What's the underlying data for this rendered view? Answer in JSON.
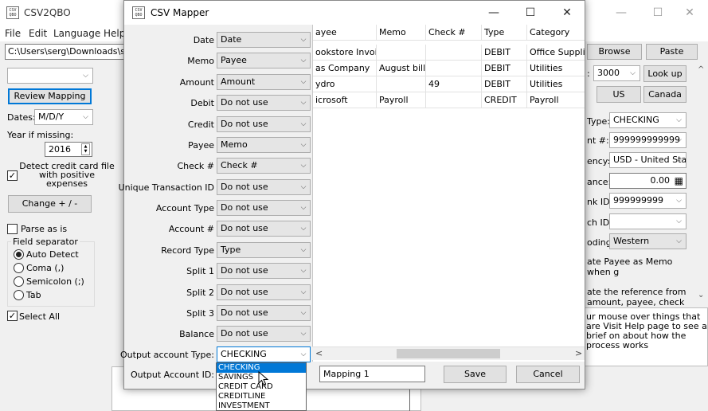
{
  "main": {
    "icon_text": "CSV\nQBO",
    "title": "CSV2QBO",
    "menu": [
      "File",
      "Edit",
      "Language",
      "Help"
    ],
    "path": "C:\\Users\\serg\\Downloads\\sampl",
    "review_mapping": "Review Mapping",
    "dates_label": "Dates:",
    "dates_value": "M/D/Y",
    "year_label": "Year if missing:",
    "year_value": "2016",
    "detect_label": "Detect credit card file with positive expenses",
    "change_label": "Change + / -",
    "parse_label": "Parse as is",
    "separator_title": "Field separator",
    "sep_auto": "Auto Detect",
    "sep_coma": "Coma (,)",
    "sep_semicolon": "Semicolon (;)",
    "sep_tab": "Tab",
    "select_all": "Select All",
    "browse": "Browse",
    "paste": "Paste",
    "colon": ":",
    "lookup_value": "3000",
    "lookup": "Look up",
    "us": "US",
    "canada": "Canada",
    "type_label": "Type:",
    "type_value": "CHECKING",
    "acct_label": "nt #:",
    "acct_value": "999999999999",
    "currency_label": "ency:",
    "currency_value": "USD - United Sta",
    "balance_label": "ance:",
    "balance_value": "0.00",
    "bankid_label": "nk ID:",
    "bankid_value": "999999999",
    "branchid_label": "ch ID:",
    "encoding_label": "oding:",
    "encoding_value": "Western",
    "payee_memo": "ate Payee as Memo when g",
    "reference": "ate the reference from amount, payee, check",
    "hint": "ur mouse over things that are Visit Help page to see a brief on about how the process works"
  },
  "mapper": {
    "title": "CSV Mapper",
    "icon_text": "CSV\nQBO",
    "fields": [
      {
        "label": "Date",
        "value": "Date"
      },
      {
        "label": "Memo",
        "value": "Payee"
      },
      {
        "label": "Amount",
        "value": "Amount"
      },
      {
        "label": "Debit",
        "value": "Do not use"
      },
      {
        "label": "Credit",
        "value": "Do not use"
      },
      {
        "label": "Payee",
        "value": "Memo"
      },
      {
        "label": "Check #",
        "value": "Check #"
      },
      {
        "label": "Unique Transaction ID",
        "value": "Do not use"
      },
      {
        "label": "Account Type",
        "value": "Do not use"
      },
      {
        "label": "Account #",
        "value": "Do not use"
      },
      {
        "label": "Record Type",
        "value": "Type"
      },
      {
        "label": "Split 1",
        "value": "Do not use"
      },
      {
        "label": "Split 2",
        "value": "Do not use"
      },
      {
        "label": "Split 3",
        "value": "Do not use"
      },
      {
        "label": "Balance",
        "value": "Do not use"
      }
    ],
    "output_type_label": "Output account Type:",
    "output_type_value": "CHECKING",
    "output_id_label": "Output Account ID:",
    "dropdown_options": [
      "CHECKING",
      "SAVINGS",
      "CREDIT CARD",
      "CREDITLINE",
      "INVESTMENT"
    ],
    "columns": [
      "ayee",
      "Memo",
      "Check #",
      "Type",
      "Category"
    ],
    "rows": [
      [
        "ookstore Invoice",
        "",
        "",
        "DEBIT",
        "Office Supplies"
      ],
      [
        "as Company",
        "August bill",
        "",
        "DEBIT",
        "Utilities"
      ],
      [
        "ydro",
        "",
        "49",
        "DEBIT",
        "Utilities"
      ],
      [
        "icrosoft",
        "Payroll",
        "",
        "CREDIT",
        "Payroll"
      ]
    ],
    "mapping_name": "Mapping 1",
    "save": "Save",
    "cancel": "Cancel"
  },
  "glyphs": {
    "minimize": "—",
    "maximize": "☐",
    "close": "✕",
    "combo_arrow": "⌵",
    "scroll_up": "^",
    "scroll_down": "⌄",
    "scroll_left": "<",
    "scroll_right": ">",
    "check": "✓",
    "spin_up": "▲",
    "spin_down": "▼",
    "calc": "▦"
  }
}
